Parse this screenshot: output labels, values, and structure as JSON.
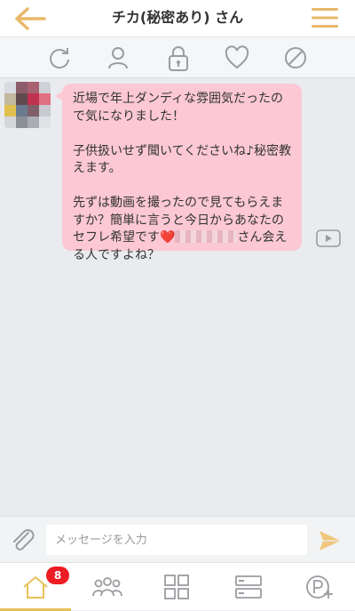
{
  "header": {
    "title": "チカ(秘密あり) さん",
    "back_icon": "back-arrow-icon",
    "menu_icon": "hamburger-menu-icon",
    "accent_color": "#e8b86a"
  },
  "toolbar": {
    "icons": [
      "refresh-icon",
      "user-profile-icon",
      "lock-icon",
      "heart-icon",
      "block-icon"
    ]
  },
  "message": {
    "paragraph_1": "近場で年上ダンディな雰囲気だったので気になりました！",
    "paragraph_2": "子供扱いせず聞いてくださいね♪秘密教えます。",
    "paragraph_3_start": "先ずは動画を撮ったので見てもらえますか？簡単に言うと今日からあなたのセフレ希望です",
    "heart": "❤️",
    "paragraph_3_end": "さん会える人ですよね？",
    "bubble_color": "#fbc8d4",
    "video_icon": "video-play-icon"
  },
  "composer": {
    "placeholder": "メッセージを入力",
    "value": "",
    "attach_icon": "paperclip-icon",
    "send_icon": "send-icon"
  },
  "bottom_nav": {
    "items": [
      "home-icon",
      "group-icon",
      "grid-icon",
      "list-icon",
      "points-icon"
    ],
    "badge": "8",
    "badge_color": "#ee1c24"
  }
}
